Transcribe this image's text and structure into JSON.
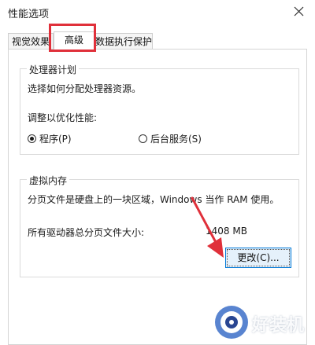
{
  "window": {
    "title": "性能选项"
  },
  "tabs": [
    {
      "label": "视觉效果"
    },
    {
      "label": "高级"
    },
    {
      "label": "数据执行保护"
    }
  ],
  "processor": {
    "group_title": "处理器计划",
    "description": "选择如何分配处理器资源。",
    "adjust_label": "调整以优化性能:",
    "option_programs": "程序(P)",
    "option_background": "后台服务(S)",
    "selected": "程序(P)"
  },
  "virtual_memory": {
    "group_title": "虚拟内存",
    "description": "分页文件是硬盘上的一块区域，Windows 当作 RAM 使用。",
    "total_label": "所有驱动器总分页文件大小:",
    "total_value": "1408 MB",
    "change_button": "更改(C)..."
  },
  "watermark": {
    "text": "好装机"
  },
  "colors": {
    "annotation": "#e0303a",
    "button_border": "#0078d7",
    "button_fill": "#e5f1fb"
  }
}
